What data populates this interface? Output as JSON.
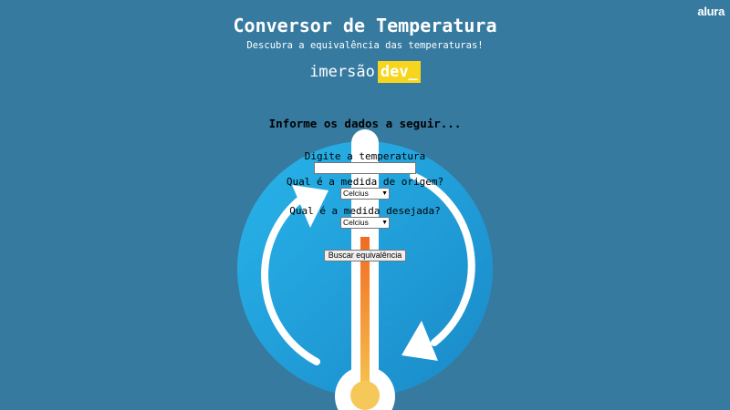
{
  "brand": {
    "logo_text": "alura"
  },
  "header": {
    "title": "Conversor de Temperatura",
    "subtitle": "Descubra a equivalência das temperaturas!"
  },
  "event": {
    "word": "imersão",
    "tag": "dev_",
    "tag_color": "#f7d51d"
  },
  "form": {
    "heading": "Informe os dados a seguir...",
    "temperature_label": "Digite a temperatura",
    "temperature_value": "",
    "origin_label": "Qual é a medida de origem?",
    "origin_selected": "Celcius",
    "target_label": "Qual é a medida desejada?",
    "target_selected": "Celcius",
    "submit_label": "Buscar equivalência"
  },
  "illustration": {
    "icon": "thermometer-cycle-icon",
    "circle_color": "#1fa5dd",
    "mercury_color": "#f07a25",
    "bulb_color": "#f6c85a"
  },
  "colors": {
    "background": "#367aa0",
    "text": "#ffffff"
  }
}
